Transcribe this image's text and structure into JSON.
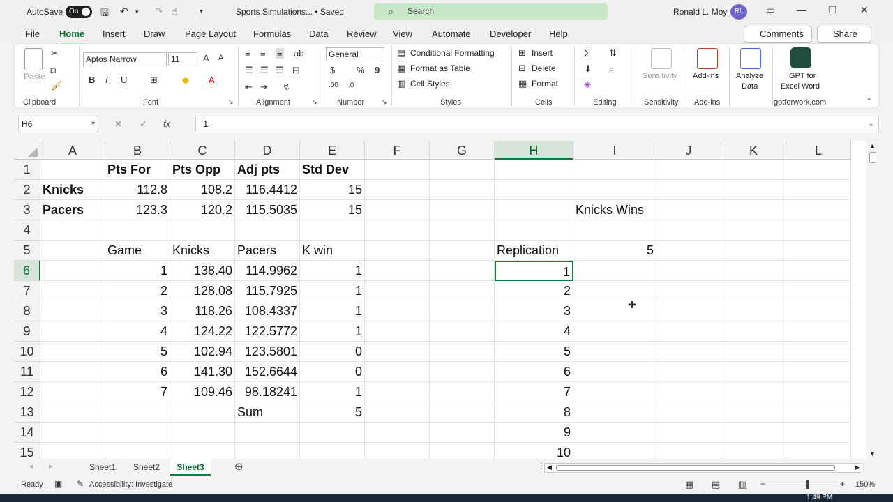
{
  "titlebar": {
    "autosave_label": "AutoSave",
    "autosave_state": "On",
    "doc_title": "Sports Simulations... • Saved",
    "search_placeholder": "Search",
    "user_name": "Ronald L. Moy",
    "user_initials": "RL"
  },
  "menu": {
    "tabs": [
      "File",
      "Home",
      "Insert",
      "Draw",
      "Page Layout",
      "Formulas",
      "Data",
      "Review",
      "View",
      "Automate",
      "Developer",
      "Help"
    ],
    "active": "Home",
    "comments": "Comments",
    "share": "Share"
  },
  "ribbon": {
    "clipboard": {
      "label": "Clipboard",
      "paste": "Paste"
    },
    "font": {
      "label": "Font",
      "name": "Aptos Narrow",
      "size": "11"
    },
    "alignment": {
      "label": "Alignment"
    },
    "number": {
      "label": "Number",
      "format": "General"
    },
    "styles": {
      "label": "Styles",
      "conditional": "Conditional Formatting",
      "format_table": "Format as Table",
      "cell_styles": "Cell Styles"
    },
    "cells": {
      "label": "Cells",
      "insert": "Insert",
      "delete": "Delete",
      "format": "Format"
    },
    "editing": {
      "label": "Editing"
    },
    "sensitivity": {
      "label": "Sensitivity",
      "button": "Sensitivity"
    },
    "addins": {
      "label": "Add-ins",
      "button": "Add-ins"
    },
    "analyze": {
      "line1": "Analyze",
      "line2": "Data"
    },
    "gpt": {
      "label": "gptforwork.com",
      "line1": "GPT for",
      "line2": "Excel Word"
    }
  },
  "formula_bar": {
    "name_box": "H6",
    "fx": "fx",
    "formula": "1"
  },
  "sheet": {
    "columns": [
      "A",
      "B",
      "C",
      "D",
      "E",
      "F",
      "G",
      "H",
      "I",
      "J",
      "K",
      "L"
    ],
    "rows": [
      "1",
      "2",
      "3",
      "4",
      "5",
      "6",
      "7",
      "8",
      "9",
      "10",
      "11",
      "12",
      "13",
      "14",
      "15"
    ],
    "selected_col": "H",
    "selected_row": "6",
    "cells": {
      "B1": "Pts For",
      "C1": "Pts Opp",
      "D1": "Adj pts",
      "E1": "Std Dev",
      "A2": "Knicks",
      "B2": "112.8",
      "C2": "108.2",
      "D2": "116.4412",
      "E2": "15",
      "A3": "Pacers",
      "B3": "123.3",
      "C3": "120.2",
      "D3": "115.5035",
      "E3": "15",
      "I3": "Knicks Wins",
      "B5": "Game",
      "C5": "Knicks",
      "D5": "Pacers",
      "E5": "K win",
      "H5": "Replication",
      "I5": "5",
      "B6": "1",
      "C6": "138.40",
      "D6": "114.9962",
      "E6": "1",
      "H6": "1",
      "B7": "2",
      "C7": "128.08",
      "D7": "115.7925",
      "E7": "1",
      "H7": "2",
      "B8": "3",
      "C8": "118.26",
      "D8": "108.4337",
      "E8": "1",
      "H8": "3",
      "B9": "4",
      "C9": "124.22",
      "D9": "122.5772",
      "E9": "1",
      "H9": "4",
      "B10": "5",
      "C10": "102.94",
      "D10": "123.5801",
      "E10": "0",
      "H10": "5",
      "B11": "6",
      "C11": "141.30",
      "D11": "152.6644",
      "E11": "0",
      "H11": "6",
      "B12": "7",
      "C12": "109.46",
      "D12": "98.18241",
      "E12": "1",
      "H12": "7",
      "D13": "Sum",
      "E13": "5",
      "H13": "8",
      "H14": "9",
      "H15": "10"
    }
  },
  "sheet_tabs": [
    "Sheet1",
    "Sheet2",
    "Sheet3"
  ],
  "active_sheet": "Sheet3",
  "status": {
    "ready": "Ready",
    "accessibility": "Accessibility: Investigate",
    "zoom": "150%"
  },
  "taskbar": {
    "clock": "1:49 PM"
  }
}
